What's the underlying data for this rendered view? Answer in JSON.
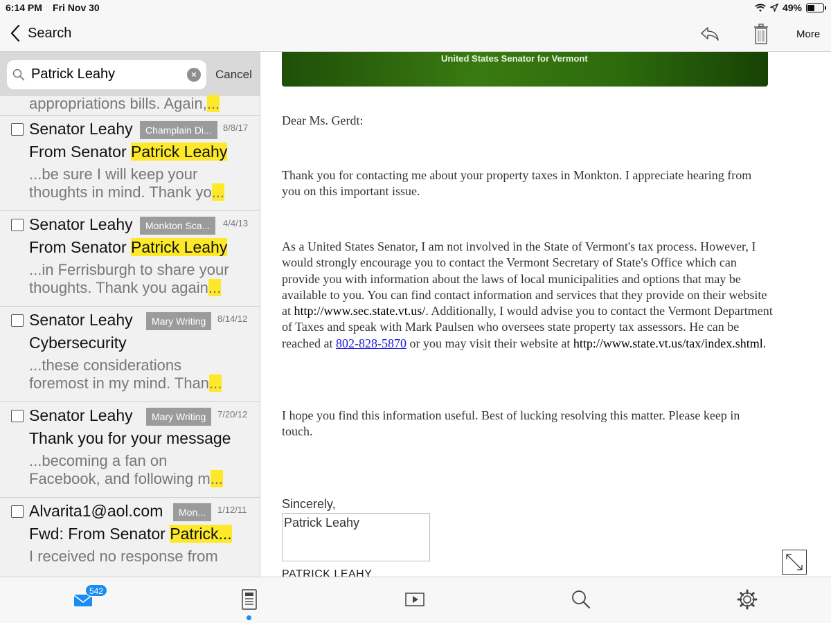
{
  "status_bar": {
    "time": "6:14 PM",
    "date": "Fri Nov 30",
    "battery": "49%",
    "battery_level": 0.49
  },
  "nav": {
    "back_label": "Search",
    "more_label": "More"
  },
  "search": {
    "query": "Patrick Leahy",
    "cancel_label": "Cancel",
    "clear_icon": "×"
  },
  "list": {
    "partial_snippet": "appropriations bills. Again,",
    "ellipsis": "...",
    "items": [
      {
        "sender": "Senator Leahy",
        "tag": "Champlain Di...",
        "date": "8/8/17",
        "subject_prefix": "From Senator ",
        "subject_highlight": "Patrick Leahy",
        "snippet1": "...be sure I will keep your",
        "snippet2": "thoughts in mind. Thank yo"
      },
      {
        "sender": "Senator Leahy",
        "tag": "Monkton Sca...",
        "date": "4/4/13",
        "subject_prefix": "From Senator ",
        "subject_highlight": "Patrick Leahy",
        "snippet1": "...in Ferrisburgh to share your",
        "snippet2": "thoughts. Thank you again"
      },
      {
        "sender": "Senator Leahy",
        "tag": "Mary Writing",
        "date": "8/14/12",
        "subject_prefix": "Cybersecurity",
        "subject_highlight": "",
        "snippet1": "...these considerations",
        "snippet2": "foremost in my mind. Than"
      },
      {
        "sender": "Senator Leahy",
        "tag": "Mary Writing",
        "date": "7/20/12",
        "subject_prefix": "Thank you for your message",
        "subject_highlight": "",
        "snippet1": "...becoming a fan on",
        "snippet2": "Facebook, and following m"
      },
      {
        "sender": "Alvarita1@aol.com",
        "tag": "Mon...",
        "date": "1/12/11",
        "subject_prefix": "Fwd: From Senator ",
        "subject_highlight": "Patrick...",
        "snippet1": "I received no response from",
        "snippet2": ""
      }
    ]
  },
  "message": {
    "banner_text": "United States Senator for Vermont",
    "greeting": "Dear Ms. Gerdt:",
    "p1": "Thank you for contacting me about your property taxes in Monkton.  I appreciate hearing from you on this important issue.",
    "p2_a": "As a United States Senator, I am not involved in the State of Vermont's tax process. However, I would strongly encourage you to contact the Vermont Secretary of State's Office which can provide you with information about the laws of local municipalities and options that may be available to you.  You can find contact information and services that they provide on their website at ",
    "p2_url1": "http://www.sec.state.vt.us/",
    "p2_b": ".  Additionally, I would advise you to contact the Vermont Department of Taxes and speak with Mark Paulsen who oversees state property tax assessors.  He can be reached at ",
    "p2_phone": "802-828-5870",
    "p2_c": " or you may visit their website at ",
    "p2_url2": "http://www.state.vt.us/tax/index.shtml",
    "p2_end": ".",
    "p3": "I hope you find this information useful.  Best of lucking resolving this matter.  Please keep in touch.",
    "closing": "Sincerely,",
    "signature": "Patrick Leahy",
    "signature_caps": "PATRICK LEAHY"
  },
  "tab_bar": {
    "mail_badge": "542",
    "tabs": [
      "mail-icon",
      "document-icon",
      "video-icon",
      "search-icon",
      "gear-icon"
    ],
    "accent": "#1a8cf2",
    "highlight": "#fde82a"
  }
}
